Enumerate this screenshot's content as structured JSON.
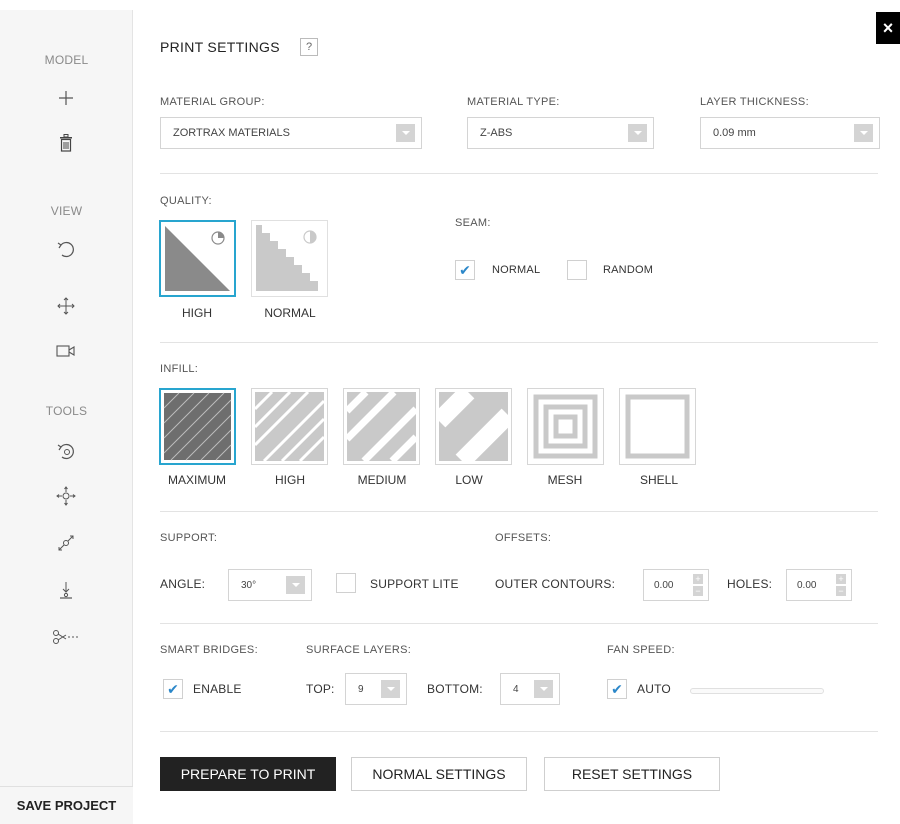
{
  "sidebar": {
    "model_heading": "MODEL",
    "view_heading": "VIEW",
    "tools_heading": "TOOLS",
    "model_icons": [
      "plus-icon",
      "trash-icon"
    ],
    "view_icons": [
      "rotate-view-icon",
      "pan-icon",
      "camera-icon"
    ],
    "tools_icons": [
      "rotate-tool-icon",
      "move-tool-icon",
      "scale-tool-icon",
      "place-on-bed-icon",
      "cut-icon"
    ],
    "save_label": "SAVE PROJECT"
  },
  "close_label": "×",
  "title": "PRINT SETTINGS",
  "help_label": "?",
  "material_group": {
    "label": "MATERIAL GROUP:",
    "value": "ZORTRAX MATERIALS"
  },
  "material_type": {
    "label": "MATERIAL TYPE:",
    "value": "Z-ABS"
  },
  "layer_thickness": {
    "label": "LAYER THICKNESS:",
    "value": "0.09 mm"
  },
  "quality": {
    "label": "QUALITY:",
    "options": [
      {
        "label": "HIGH",
        "selected": true
      },
      {
        "label": "NORMAL",
        "selected": false
      }
    ]
  },
  "seam": {
    "label": "SEAM:",
    "normal_label": "NORMAL",
    "normal_checked": true,
    "random_label": "RANDOM",
    "random_checked": false
  },
  "infill": {
    "label": "INFILL:",
    "options": [
      {
        "label": "MAXIMUM",
        "selected": true
      },
      {
        "label": "HIGH",
        "selected": false
      },
      {
        "label": "MEDIUM",
        "selected": false
      },
      {
        "label": "LOW",
        "selected": false
      },
      {
        "label": "MESH",
        "selected": false
      },
      {
        "label": "SHELL",
        "selected": false
      }
    ]
  },
  "support": {
    "label": "SUPPORT:",
    "angle_label": "ANGLE:",
    "angle_value": "30°",
    "lite_label": "SUPPORT LITE",
    "lite_checked": false
  },
  "offsets": {
    "label": "OFFSETS:",
    "outer_label": "OUTER CONTOURS:",
    "outer_value": "0.00",
    "holes_label": "HOLES:",
    "holes_value": "0.00"
  },
  "smart_bridges": {
    "label": "SMART BRIDGES:",
    "enable_label": "ENABLE",
    "checked": true
  },
  "surface_layers": {
    "label": "SURFACE LAYERS:",
    "top_label": "TOP:",
    "top_value": "9",
    "bottom_label": "BOTTOM:",
    "bottom_value": "4"
  },
  "fan_speed": {
    "label": "FAN SPEED:",
    "auto_label": "AUTO",
    "checked": true
  },
  "buttons": {
    "prepare": "PREPARE TO PRINT",
    "normal": "NORMAL SETTINGS",
    "reset": "RESET SETTINGS"
  },
  "colors": {
    "accent": "#28a5cf",
    "check": "#2b87c9",
    "primary_button": "#222222"
  }
}
